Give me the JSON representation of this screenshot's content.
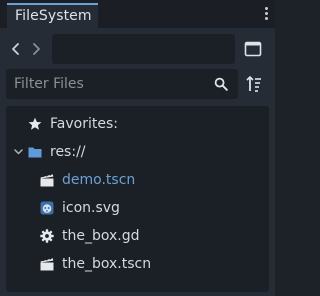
{
  "tab": {
    "label": "FileSystem"
  },
  "toolbar": {
    "back_icon": "chevron-left-icon",
    "forward_icon": "chevron-right-icon",
    "path_value": "",
    "split_icon": "split-view-icon"
  },
  "filter": {
    "placeholder": "Filter Files",
    "search_icon": "search-icon",
    "sort_icon": "sort-icon"
  },
  "tree": {
    "favorites": {
      "label": "Favorites:",
      "icon": "star-icon"
    },
    "root": {
      "label": "res://",
      "icon": "folder-icon",
      "expanded": true
    },
    "items": [
      {
        "label": "demo.tscn",
        "icon": "scene-icon",
        "selected": true
      },
      {
        "label": "icon.svg",
        "icon": "godot-image-icon",
        "selected": false
      },
      {
        "label": "the_box.gd",
        "icon": "gear-script-icon",
        "selected": false
      },
      {
        "label": "the_box.tscn",
        "icon": "scene-icon",
        "selected": false
      }
    ]
  },
  "colors": {
    "accent": "#6ca1d6",
    "panel_bg": "#262c35",
    "field_bg": "#1b2026",
    "folder": "#5f9bd8"
  }
}
